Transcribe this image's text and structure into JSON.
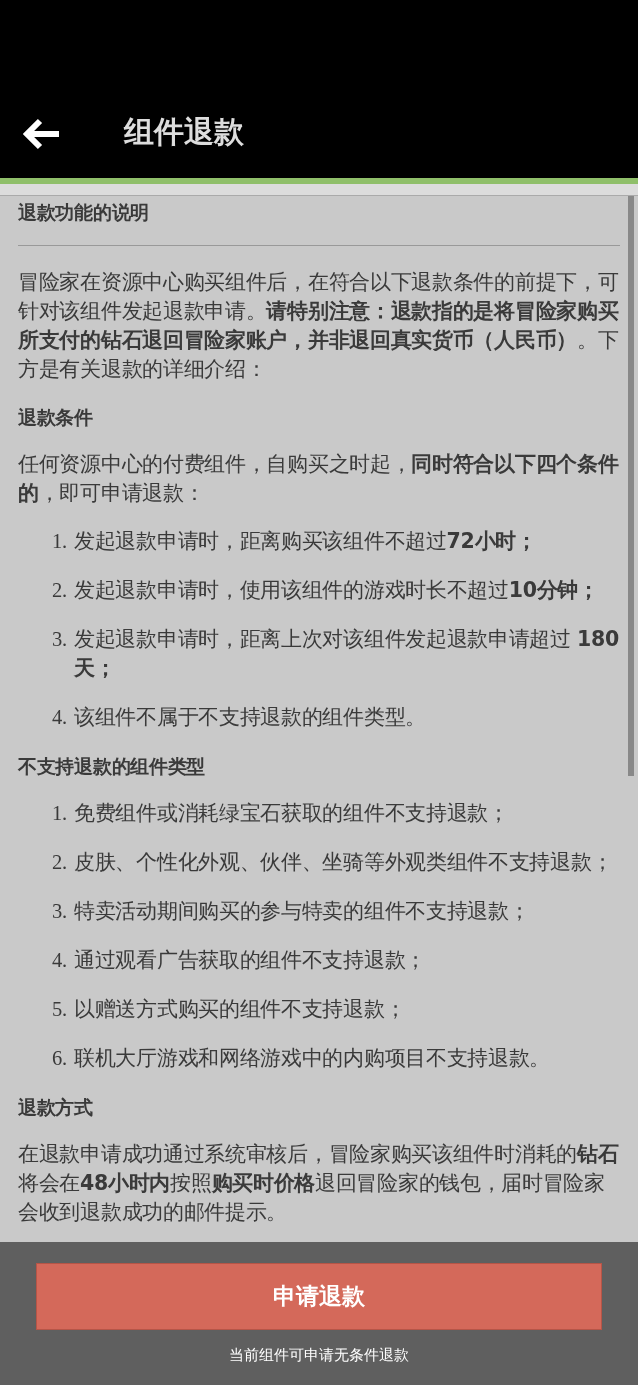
{
  "header": {
    "title": "组件退款"
  },
  "content": [
    {
      "kind": "heading",
      "text": "退款功能的说明"
    },
    {
      "kind": "divider"
    },
    {
      "kind": "paragraph",
      "text": "冒险家在资源中心购买组件后，在符合以下退款条件的前提下，可针对该组件发起退款申请。**请特别注意：退款指的是将冒险家购买所支付的钻石退回冒险家账户，并非退回真实货币（人民币）**。下方是有关退款的详细介绍："
    },
    {
      "kind": "heading",
      "text": "退款条件"
    },
    {
      "kind": "paragraph",
      "text": "任何资源中心的付费组件，自购买之时起，**同时符合以下四个条件的**，即可申请退款："
    },
    {
      "kind": "list",
      "items": [
        {
          "number": "1.",
          "text": "发起退款申请时，距离购买该组件不超过**72小时；**"
        },
        {
          "number": "2.",
          "text": "发起退款申请时，使用该组件的游戏时长不超过**10分钟；**"
        },
        {
          "number": "3.",
          "text": "发起退款申请时，距离上次对该组件发起退款申请超过 **180天；**"
        },
        {
          "number": "4.",
          "text": "该组件不属于不支持退款的组件类型。"
        }
      ]
    },
    {
      "kind": "heading",
      "text": "不支持退款的组件类型"
    },
    {
      "kind": "list",
      "items": [
        {
          "number": "1.",
          "text": "免费组件或消耗绿宝石获取的组件不支持退款；"
        },
        {
          "number": "2.",
          "text": "皮肤、个性化外观、伙伴、坐骑等外观类组件不支持退款；"
        },
        {
          "number": "3.",
          "text": "特卖活动期间购买的参与特卖的组件不支持退款；"
        },
        {
          "number": "4.",
          "text": "通过观看广告获取的组件不支持退款；"
        },
        {
          "number": "5.",
          "text": "以赠送方式购买的组件不支持退款；"
        },
        {
          "number": "6.",
          "text": "联机大厅游戏和网络游戏中的内购项目不支持退款。"
        }
      ]
    },
    {
      "kind": "heading",
      "text": "退款方式"
    },
    {
      "kind": "paragraph",
      "text": "在退款申请成功通过系统审核后，冒险家购买该组件时消耗的**钻石**将会在**48小时内**按照**购买时价格**退回冒险家的钱包，届时冒险家会收到退款成功的邮件提示。"
    }
  ],
  "footer": {
    "button": "申请退款",
    "note": "当前组件可申请无条件退款"
  }
}
